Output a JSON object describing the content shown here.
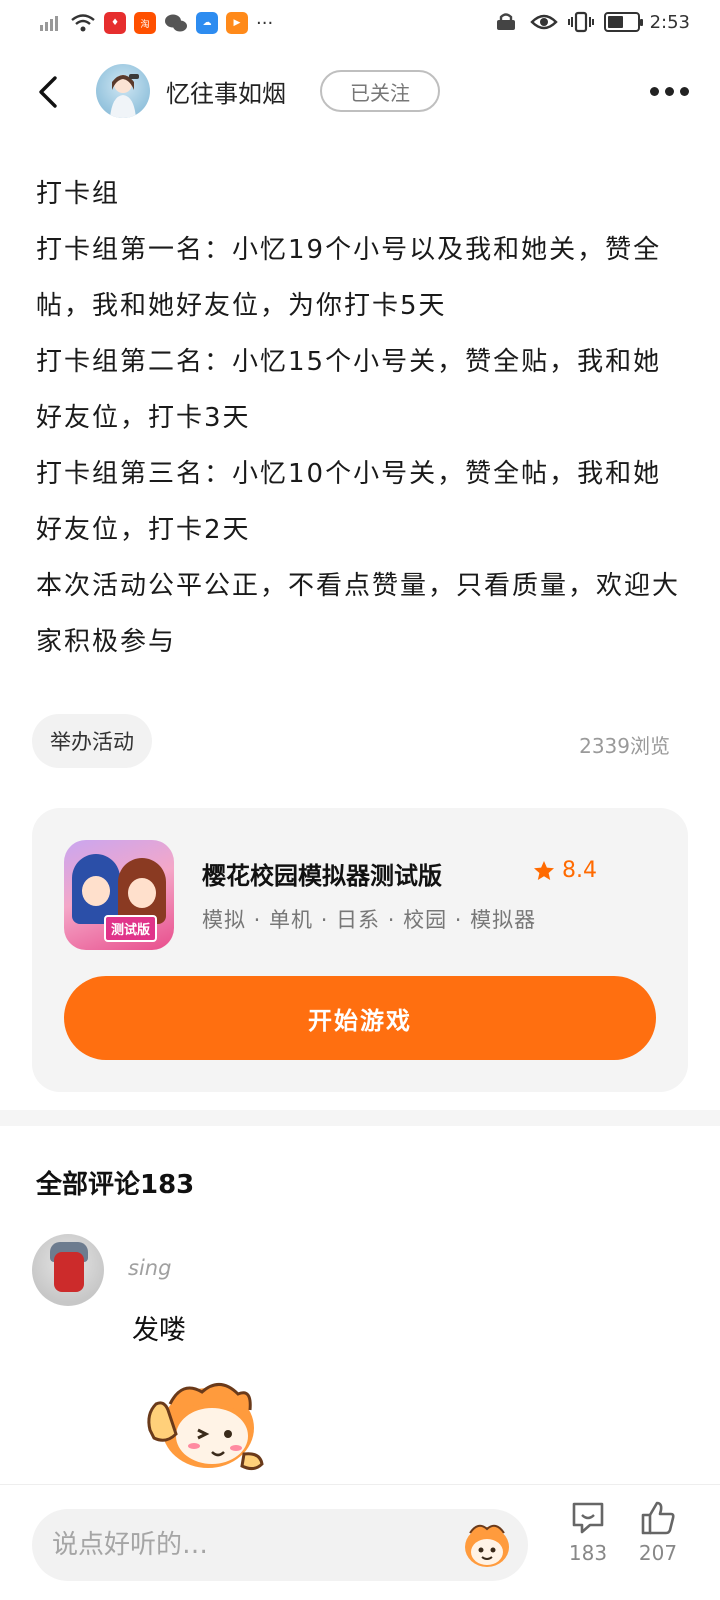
{
  "status_bar": {
    "time": "2:53",
    "left_icons": [
      "sim-signal-icon",
      "wifi-icon",
      "app-notification-icon",
      "taobao-icon",
      "wechat-icon",
      "cloud-icon",
      "video-icon",
      "more-dots-icon"
    ],
    "right_icons": [
      "vpn-icon",
      "eye-comfort-icon",
      "vibrate-icon",
      "battery-icon"
    ],
    "battery_level": 0.55
  },
  "header": {
    "author_name": "忆往事如烟",
    "follow_label": "已关注"
  },
  "post": {
    "paragraphs": [
      "打卡组",
      "打卡组第一名：小忆19个小号以及我和她关，赞全帖，我和她好友位，为你打卡5天",
      "打卡组第二名：小忆15个小号关，赞全贴，我和她好友位，打卡3天",
      "打卡组第三名：小忆10个小号关，赞全帖，我和她好友位，打卡2天",
      "本次活动公平公正，不看点赞量，只看质量，欢迎大家积极参与"
    ],
    "tag": "举办活动",
    "views": "2339浏览"
  },
  "game": {
    "title": "樱花校园模拟器测试版",
    "rating": "8.4",
    "tags": "模拟 · 单机 · 日系 · 校园 · 模拟器",
    "icon_badge": "测试版",
    "play_label": "开始游戏"
  },
  "comments": {
    "title": "全部评论183",
    "items": [
      {
        "user": "sing",
        "text": "发喽"
      }
    ]
  },
  "bottom_bar": {
    "input_placeholder": "说点好听的…",
    "comment_count": "183",
    "like_count": "207"
  },
  "colors": {
    "accent": "#ff6f10",
    "rating": "#ff6a00"
  }
}
